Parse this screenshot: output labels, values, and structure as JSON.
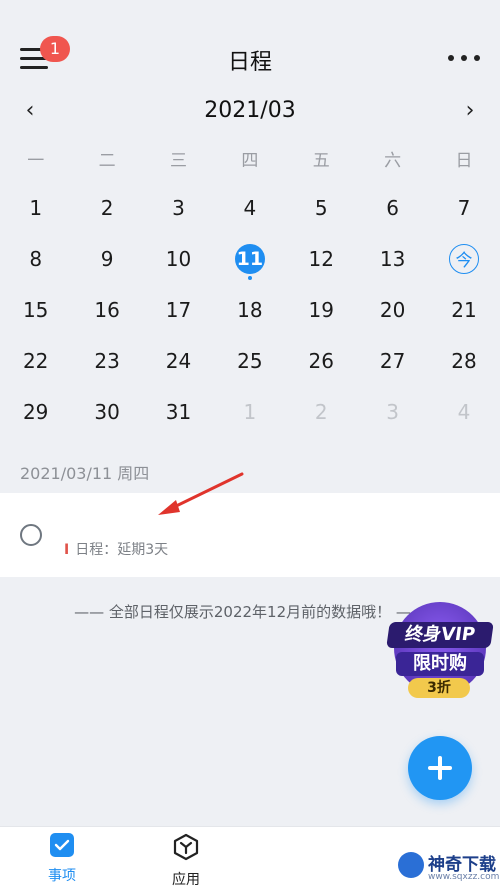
{
  "header": {
    "badge_count": "1",
    "title": "日程"
  },
  "calendar": {
    "month_label": "2021/03",
    "prev_glyph": "‹",
    "next_glyph": "›",
    "weekdays": [
      "一",
      "二",
      "三",
      "四",
      "五",
      "六",
      "日"
    ],
    "rows": [
      [
        "1",
        "2",
        "3",
        "4",
        "5",
        "6",
        "7"
      ],
      [
        "8",
        "9",
        "10",
        "11",
        "12",
        "13",
        "今"
      ],
      [
        "15",
        "16",
        "17",
        "18",
        "19",
        "20",
        "21"
      ],
      [
        "22",
        "23",
        "24",
        "25",
        "26",
        "27",
        "28"
      ],
      [
        "29",
        "30",
        "31",
        "1",
        "2",
        "3",
        "4"
      ]
    ],
    "selected_day": "11",
    "today_label": "今"
  },
  "day_panel": {
    "date_header": "2021/03/11 周四",
    "task_icon": "I",
    "task_meta": "日程：延期3天"
  },
  "footer_note": "—— 全部日程仅展示2022年12月前的数据哦！ ——",
  "promo": {
    "line1": "终身VIP",
    "line2": "限时购",
    "line3": "3折"
  },
  "bottom_nav": {
    "items": [
      {
        "label": "事项"
      },
      {
        "label": "应用"
      }
    ]
  },
  "watermark": {
    "title": "神奇下载",
    "sub": "www.sqxzz.com"
  },
  "colors": {
    "accent": "#1f8ef1",
    "badge": "#f0564f",
    "background": "#eef0f4"
  }
}
